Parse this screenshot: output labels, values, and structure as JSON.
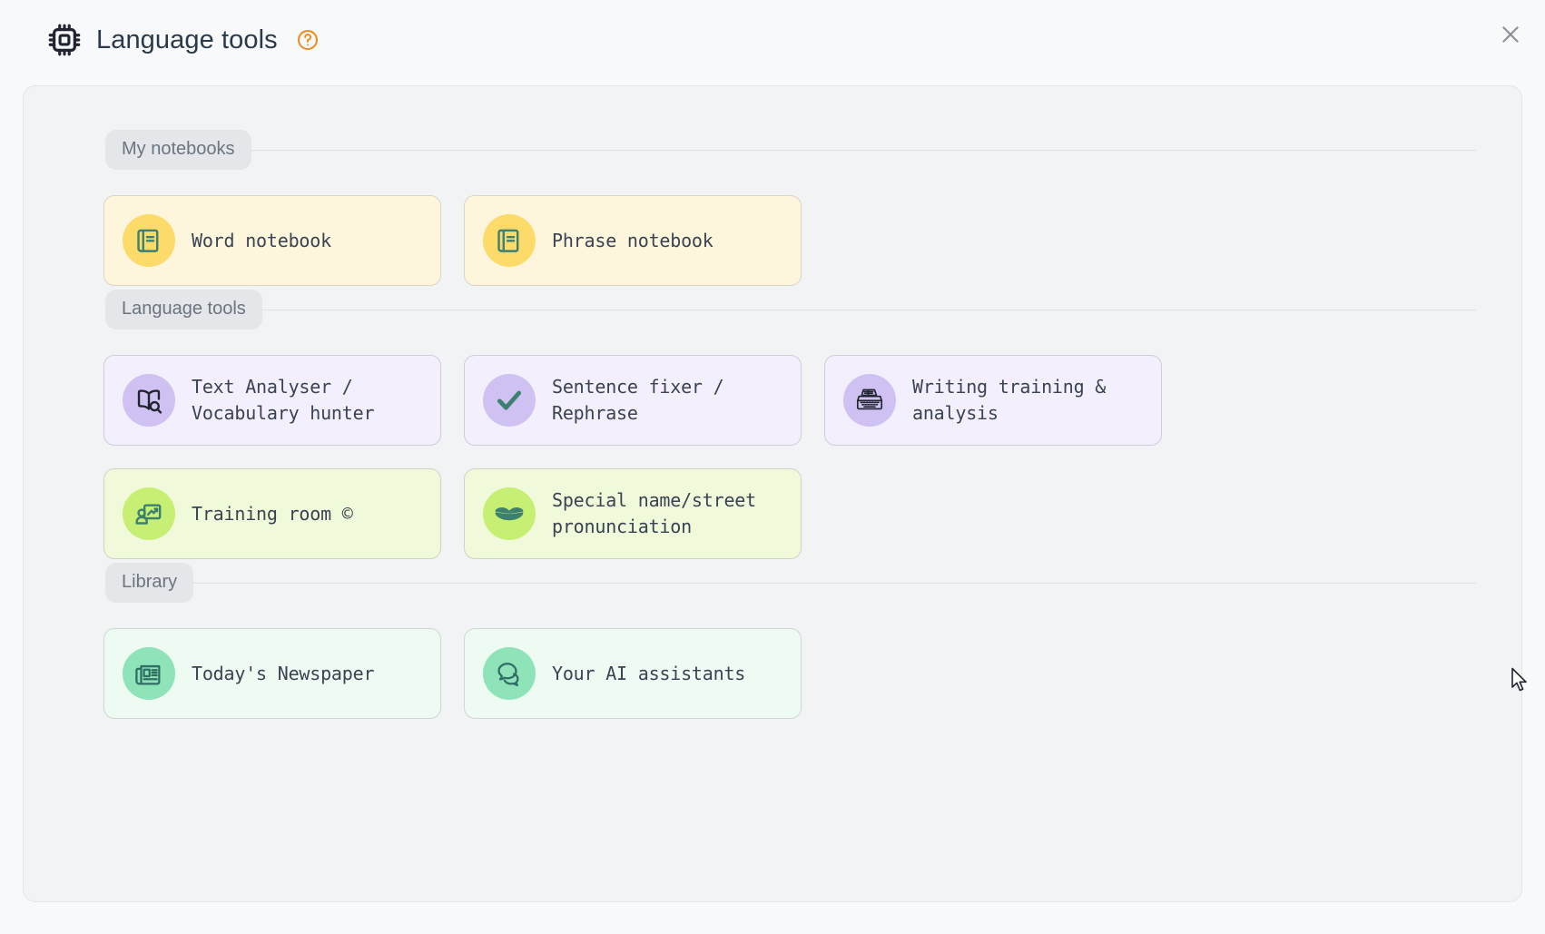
{
  "header": {
    "title": "Language tools",
    "chip_icon": "chip-icon",
    "help_icon": "help-circle-icon",
    "help_color": "#f08c1e",
    "close_icon": "close-icon"
  },
  "sections": [
    {
      "label": "My notebooks",
      "cards": [
        {
          "label": "Word notebook",
          "icon": "book-icon",
          "theme": "yellow"
        },
        {
          "label": "Phrase notebook",
          "icon": "book-icon",
          "theme": "yellow"
        }
      ]
    },
    {
      "label": "Language tools",
      "cards": [
        {
          "label": "Text Analyser /\nVocabulary hunter",
          "icon": "book-search-icon",
          "theme": "purple"
        },
        {
          "label": "Sentence fixer /\nRephrase",
          "icon": "check-icon",
          "theme": "purple"
        },
        {
          "label": "Writing training &\nanalysis",
          "icon": "typewriter-icon",
          "theme": "purple"
        },
        {
          "label": "Training room ©",
          "icon": "presentation-icon",
          "theme": "lgreen"
        },
        {
          "label": "Special name/street\npronunciation",
          "icon": "lips-icon",
          "theme": "lgreen"
        }
      ]
    },
    {
      "label": "Library",
      "cards": [
        {
          "label": "Today's Newspaper",
          "icon": "newspaper-icon",
          "theme": "mint"
        },
        {
          "label": "Your AI assistants",
          "icon": "chat-bubbles-icon",
          "theme": "mint"
        }
      ]
    }
  ],
  "colors": {
    "page_background": "#f8f9fb",
    "panel_background": "#f2f3f5",
    "title_text": "#2b3a4a",
    "pill_background": "#e4e6e9",
    "pill_text": "#6b7480",
    "card_text": "#394352",
    "yellow_card": "#fdf6dd",
    "purple_card": "#f3effd",
    "light_green_card": "#f0fada",
    "mint_card": "#eefbf3"
  }
}
